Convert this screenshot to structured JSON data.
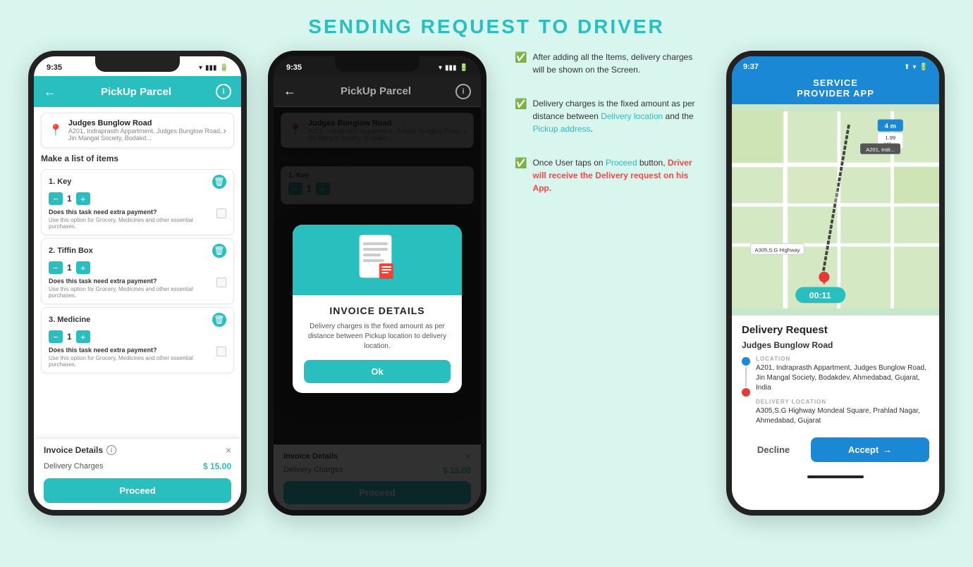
{
  "page": {
    "title": "SENDING REQUEST TO DRIVER"
  },
  "phone1": {
    "status_time": "9:35",
    "header_title": "PickUp Parcel",
    "back_label": "←",
    "info_label": "i",
    "address_main": "Judges Bunglow Road",
    "address_sub": "A201, Indraprasth Appartment, Judges Bunglow Road, Jin Mangal Society, Bodakd...",
    "section_title": "Make a list of items",
    "items": [
      {
        "num": "1.",
        "name": "Key",
        "count": "1"
      },
      {
        "num": "2.",
        "name": "Tiffin Box",
        "count": "1"
      },
      {
        "num": "3.",
        "name": "Medicine",
        "count": "1"
      }
    ],
    "extra_q": "Does this task need extra payment?",
    "extra_desc": "Use this option for Grocery, Medicines and other essential purchases.",
    "invoice_title": "Invoice Details",
    "invoice_info": "i",
    "close_label": "×",
    "delivery_charges_label": "Delivery Charges",
    "delivery_charges_amount": "$ 15.00",
    "proceed_label": "Proceed"
  },
  "phone2": {
    "status_time": "9:35",
    "header_title": "PickUp Parcel",
    "address_main": "Judges Bunglow Road",
    "address_sub": "A201, Indraprasth Appartment, Judges Bunglow Road, Jin Mangal Society, Bodakd...",
    "section_title": "Make a list of items",
    "invoice_title": "Invoice Details",
    "delivery_charges_label": "Delivery Charges",
    "delivery_charges_amount": "$ 15.00",
    "proceed_label": "Proceed",
    "dialog": {
      "title": "INVOICE DETAILS",
      "desc": "Delivery charges is the fixed amount as per distance between Pickup location to delivery location.",
      "ok_label": "Ok"
    }
  },
  "annotations": {
    "item1_text": "After adding all the Items, delivery charges will be shown on the Screen.",
    "item2_text": "Delivery charges is the fixed amount as per distance between Delivery location and the Pickup address.",
    "item3_text": "Once User taps on Proceed button, Driver will receive the Delivery request on his App."
  },
  "phone3": {
    "status_time": "9:37",
    "header_title": "SERVICE\nPROVIDER APP",
    "map_distance": "4 m",
    "map_miles": "1.99\nMiles",
    "marker_label": "A201, Indr...",
    "route_label": "A305,S.G Highway",
    "timer": "00:11",
    "delivery_request_title": "Delivery Request",
    "pickup_address_main": "Judges Bunglow Road",
    "location_label": "LOCATION",
    "location_address": "A201, Indraprasth Appartment, Judges Bunglow Road, Jin Mangal Society, Bodakdev, Ahmedabad, Gujarat, India",
    "delivery_label": "DELIVERY LOCATION",
    "delivery_address": "A305,S.G Highway\nMondeal Square, Prahlad Nagar,\nAhmedabad, Gujarat",
    "decline_label": "Decline",
    "accept_label": "Accept"
  }
}
